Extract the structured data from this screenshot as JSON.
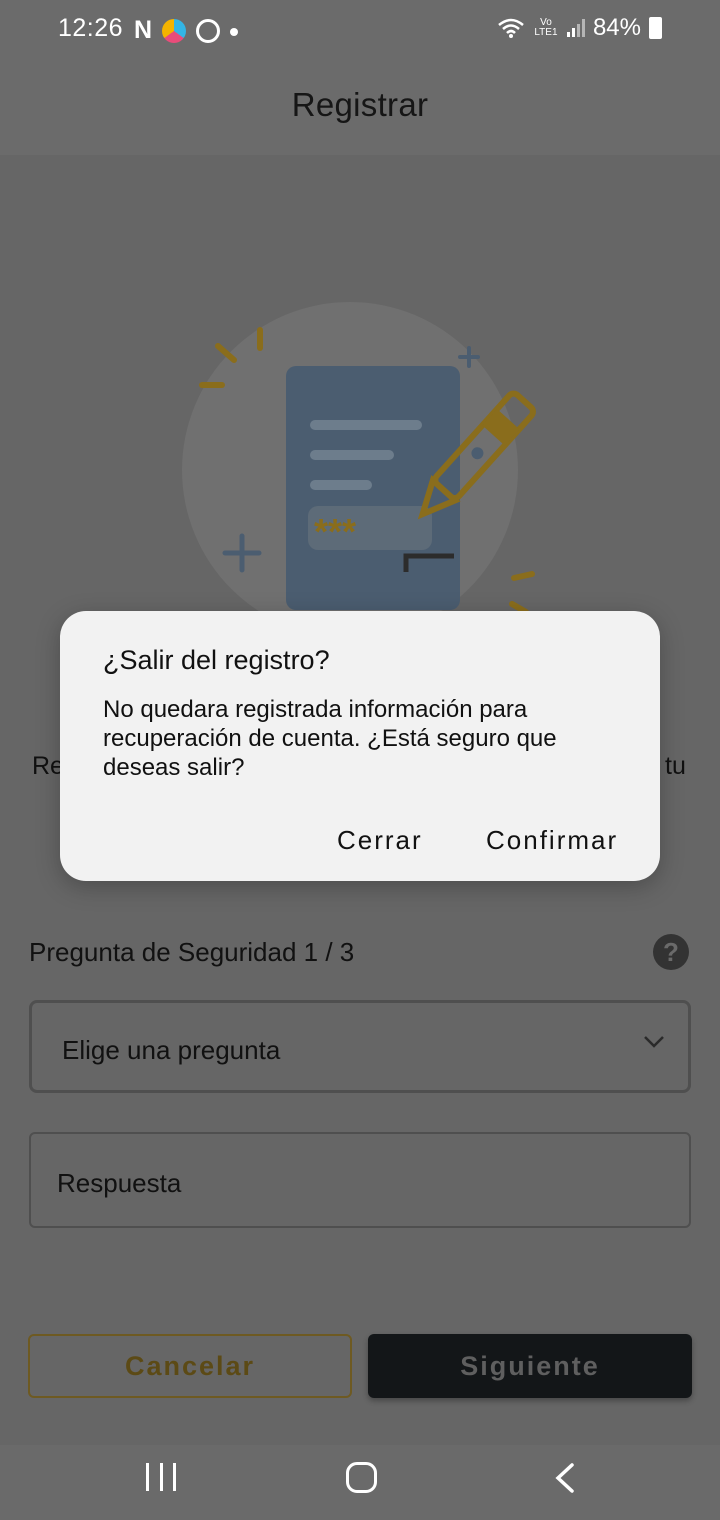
{
  "status_bar": {
    "time": "12:26",
    "notification_icons": [
      "netflix-n-icon",
      "edge-browser-icon",
      "recycle-icon",
      "dot-icon"
    ],
    "n_glyph": "N",
    "volte_label": "Vo LTE1",
    "battery": "84%"
  },
  "header": {
    "title": "Registrar"
  },
  "description": {
    "left_fragment": "Re",
    "right_fragment": "tu"
  },
  "form": {
    "question_label": "Pregunta de Seguridad 1 / 3",
    "help_glyph": "?",
    "select_placeholder": "Elige una pregunta",
    "answer_placeholder": "Respuesta"
  },
  "buttons": {
    "cancel": "Cancelar",
    "next": "Siguiente"
  },
  "dialog": {
    "title": "¿Salir del registro?",
    "message": "No quedara registrada información para recuperación de cuenta. ¿Está seguro que deseas salir?",
    "close_label": "Cerrar",
    "confirm_label": "Confirmar"
  },
  "illustration": {
    "password_mask": "***"
  },
  "colors": {
    "scrim": "#6a6a6a",
    "dialog_bg": "#f2f2f2",
    "accent_gold": "#8a6d1c",
    "doc_blue": "#4b5d70",
    "primary_button": "#131618"
  }
}
